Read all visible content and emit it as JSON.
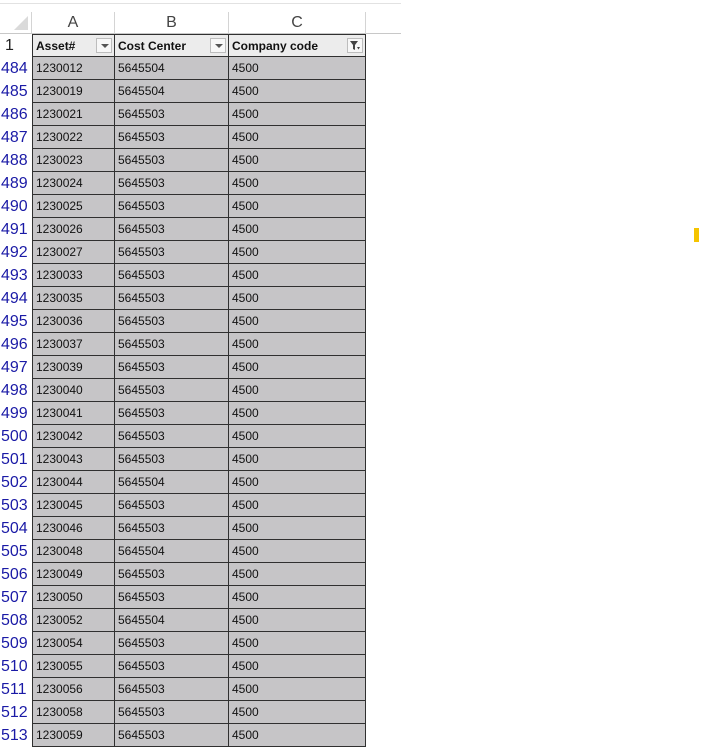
{
  "columns": {
    "a": "A",
    "b": "B",
    "c": "C"
  },
  "header_row": {
    "number": "1",
    "asset": "Asset#",
    "cost_center": "Cost Center",
    "company_code": "Company code"
  },
  "rows": [
    {
      "n": "484",
      "asset": "1230012",
      "cc": "5645504",
      "co": "4500"
    },
    {
      "n": "485",
      "asset": "1230019",
      "cc": "5645504",
      "co": "4500"
    },
    {
      "n": "486",
      "asset": "1230021",
      "cc": "5645503",
      "co": "4500"
    },
    {
      "n": "487",
      "asset": "1230022",
      "cc": "5645503",
      "co": "4500"
    },
    {
      "n": "488",
      "asset": "1230023",
      "cc": "5645503",
      "co": "4500"
    },
    {
      "n": "489",
      "asset": "1230024",
      "cc": "5645503",
      "co": "4500"
    },
    {
      "n": "490",
      "asset": "1230025",
      "cc": "5645503",
      "co": "4500"
    },
    {
      "n": "491",
      "asset": "1230026",
      "cc": "5645503",
      "co": "4500"
    },
    {
      "n": "492",
      "asset": "1230027",
      "cc": "5645503",
      "co": "4500"
    },
    {
      "n": "493",
      "asset": "1230033",
      "cc": "5645503",
      "co": "4500"
    },
    {
      "n": "494",
      "asset": "1230035",
      "cc": "5645503",
      "co": "4500"
    },
    {
      "n": "495",
      "asset": "1230036",
      "cc": "5645503",
      "co": "4500"
    },
    {
      "n": "496",
      "asset": "1230037",
      "cc": "5645503",
      "co": "4500"
    },
    {
      "n": "497",
      "asset": "1230039",
      "cc": "5645503",
      "co": "4500"
    },
    {
      "n": "498",
      "asset": "1230040",
      "cc": "5645503",
      "co": "4500"
    },
    {
      "n": "499",
      "asset": "1230041",
      "cc": "5645503",
      "co": "4500"
    },
    {
      "n": "500",
      "asset": "1230042",
      "cc": "5645503",
      "co": "4500"
    },
    {
      "n": "501",
      "asset": "1230043",
      "cc": "5645503",
      "co": "4500"
    },
    {
      "n": "502",
      "asset": "1230044",
      "cc": "5645504",
      "co": "4500"
    },
    {
      "n": "503",
      "asset": "1230045",
      "cc": "5645503",
      "co": "4500"
    },
    {
      "n": "504",
      "asset": "1230046",
      "cc": "5645503",
      "co": "4500"
    },
    {
      "n": "505",
      "asset": "1230048",
      "cc": "5645504",
      "co": "4500"
    },
    {
      "n": "506",
      "asset": "1230049",
      "cc": "5645503",
      "co": "4500"
    },
    {
      "n": "507",
      "asset": "1230050",
      "cc": "5645503",
      "co": "4500"
    },
    {
      "n": "508",
      "asset": "1230052",
      "cc": "5645504",
      "co": "4500"
    },
    {
      "n": "509",
      "asset": "1230054",
      "cc": "5645503",
      "co": "4500"
    },
    {
      "n": "510",
      "asset": "1230055",
      "cc": "5645503",
      "co": "4500"
    },
    {
      "n": "511",
      "asset": "1230056",
      "cc": "5645503",
      "co": "4500"
    },
    {
      "n": "512",
      "asset": "1230058",
      "cc": "5645503",
      "co": "4500"
    },
    {
      "n": "513",
      "asset": "1230059",
      "cc": "5645503",
      "co": "4500"
    }
  ],
  "colors": {
    "row_number": "#1a1aa6",
    "selected_fill": "#c6c5c7",
    "grid_border": "#303030"
  }
}
